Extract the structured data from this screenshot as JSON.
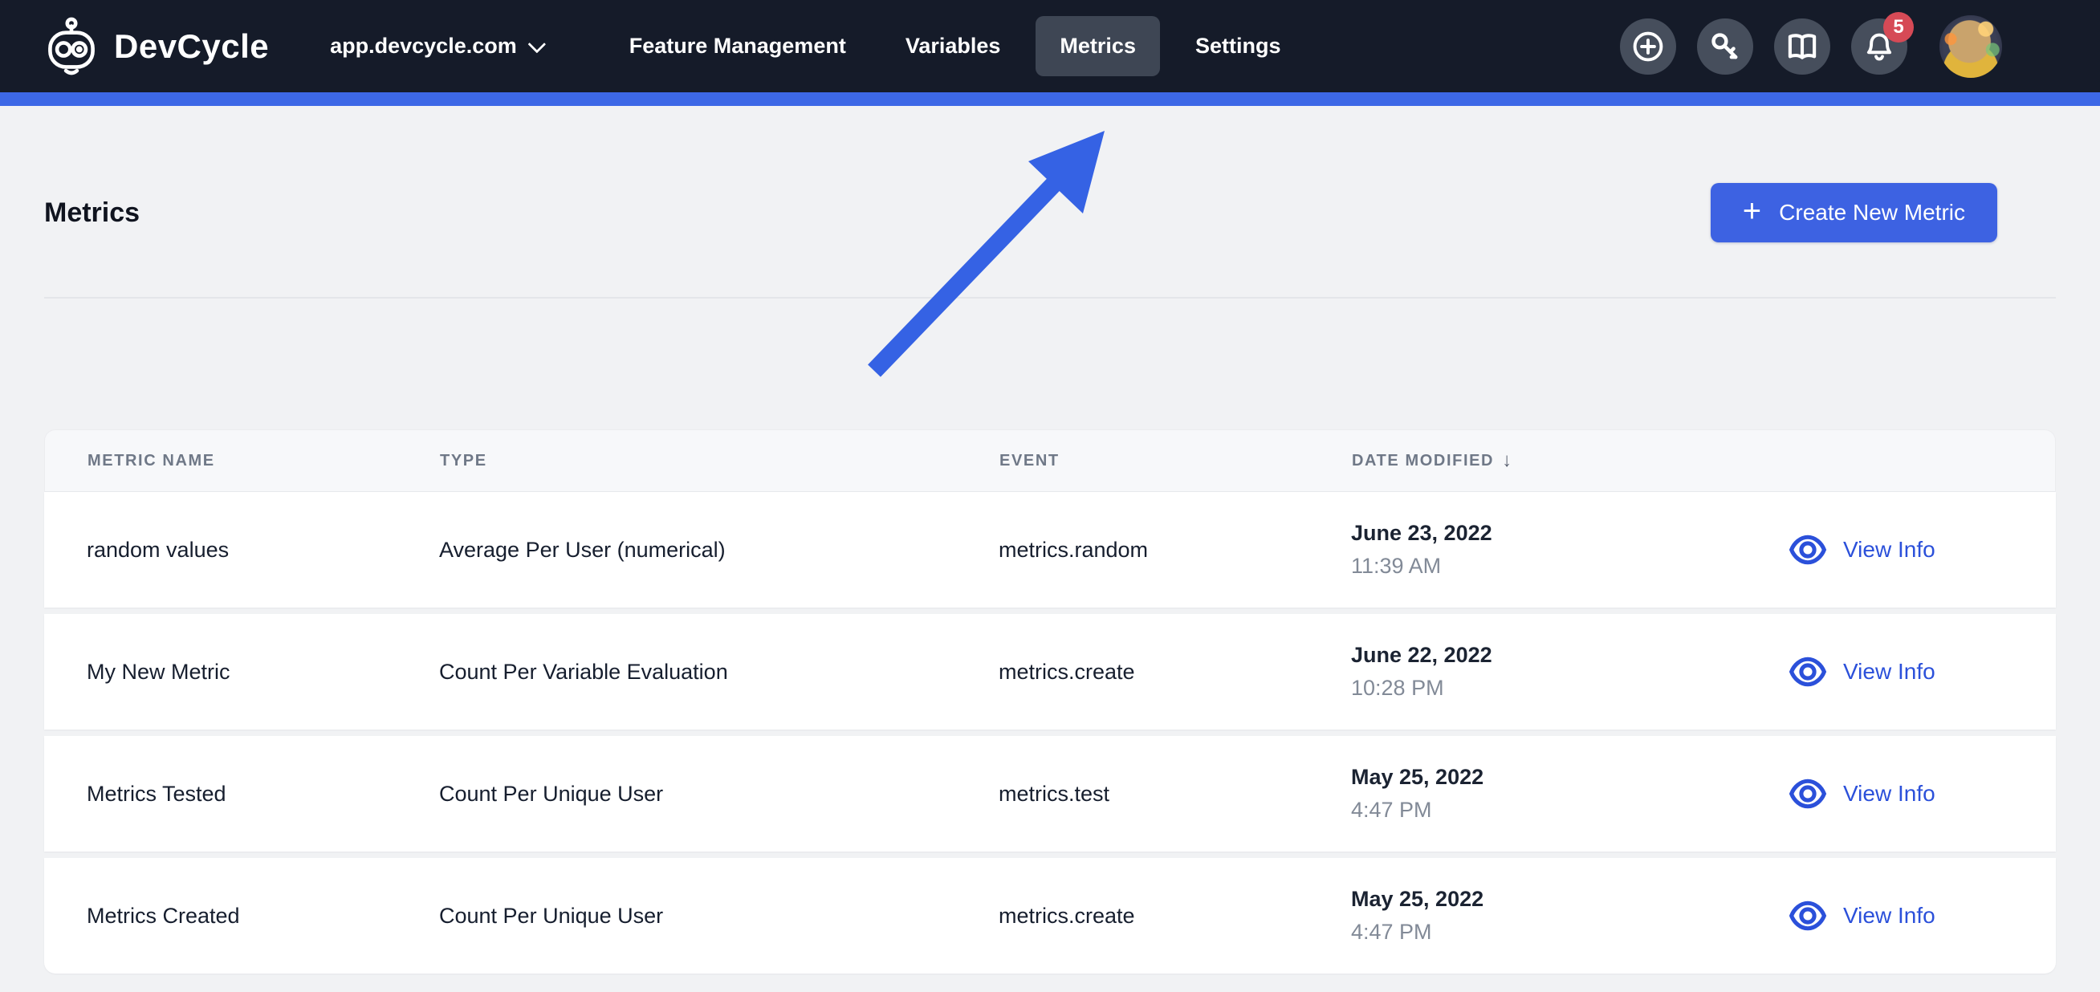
{
  "nav": {
    "brand": "DevCycle",
    "project_selector": "app.devcycle.com",
    "items": [
      {
        "label": "Feature Management",
        "active": false
      },
      {
        "label": "Variables",
        "active": false
      },
      {
        "label": "Metrics",
        "active": true
      },
      {
        "label": "Settings",
        "active": false
      }
    ],
    "icons": [
      "add-circle",
      "key",
      "docs-book",
      "notifications-bell",
      "avatar"
    ],
    "notification_count": "5"
  },
  "page": {
    "title": "Metrics",
    "create_button_label": "Create New Metric"
  },
  "annotation": {
    "type": "arrow",
    "points_to": "Metrics nav tab"
  },
  "table": {
    "columns": [
      "Metric Name",
      "Type",
      "Event",
      "Date Modified"
    ],
    "sort_column": "Date Modified",
    "sort_direction": "desc",
    "sort_indicator": "↓",
    "action_label": "View Info",
    "rows": [
      {
        "name": "random values",
        "type": "Average Per User (numerical)",
        "event": "metrics.random",
        "date": "June 23, 2022",
        "time": "11:39 AM",
        "action": "View Info"
      },
      {
        "name": "My New Metric",
        "type": "Count Per Variable Evaluation",
        "event": "metrics.create",
        "date": "June 22, 2022",
        "time": "10:28 PM",
        "action": "View Info"
      },
      {
        "name": "Metrics Tested",
        "type": "Count Per Unique User",
        "event": "metrics.test",
        "date": "May 25, 2022",
        "time": "4:47 PM",
        "action": "View Info"
      },
      {
        "name": "Metrics Created",
        "type": "Count Per Unique User",
        "event": "metrics.create",
        "date": "May 25, 2022",
        "time": "4:47 PM",
        "action": "View Info"
      }
    ]
  },
  "colors": {
    "nav_bg": "#151b29",
    "nav_active_pill": "#3e4654",
    "accent_strip": "#3d68e6",
    "button_blue": "#3d62e2",
    "link_blue": "#2b50da",
    "arrow_blue": "#3562e4",
    "badge_red": "#d64a56",
    "page_bg": "#f1f2f4"
  }
}
